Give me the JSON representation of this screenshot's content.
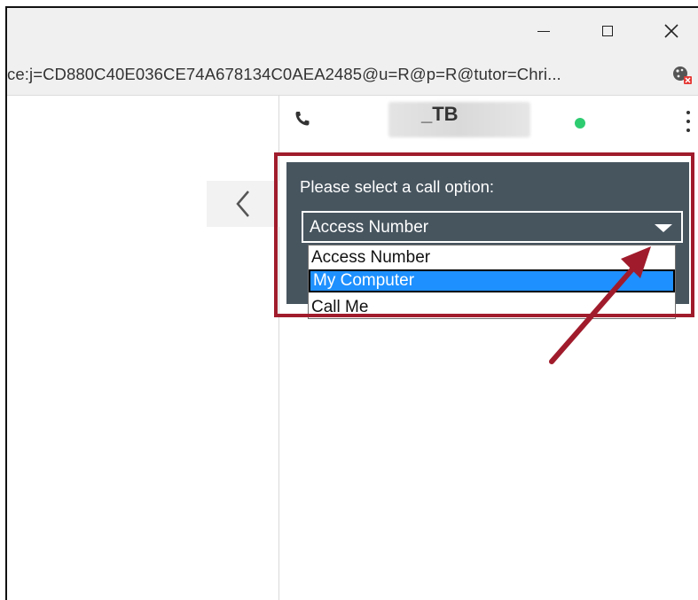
{
  "window": {
    "minimize_icon": "minimize-icon",
    "maximize_icon": "maximize-icon",
    "close_icon": "close-icon"
  },
  "address_bar": {
    "url": "ce:j=CD880C40E036CE74A678134C0AEA2485@u=R@p=R@tutor=Chri..."
  },
  "left_pane": {
    "collapse_icon": "chevron-left-icon"
  },
  "chat_header": {
    "contact_name": "_TB",
    "status_color": "#2ecc71"
  },
  "call_panel": {
    "prompt": "Please select a call option:",
    "selected": "Access Number",
    "options": [
      "Access Number",
      "My Computer",
      "Call Me"
    ],
    "highlighted_option": "My Computer"
  },
  "colors": {
    "panel_bg": "#47555f",
    "highlight_border": "#a01c2c",
    "selection": "#1e90ff"
  }
}
